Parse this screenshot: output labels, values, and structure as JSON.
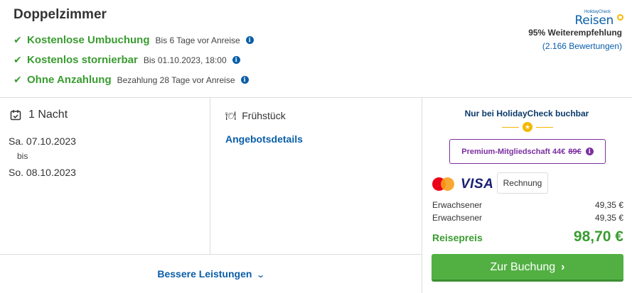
{
  "room": {
    "title": "Doppelzimmer"
  },
  "features": [
    {
      "name": "Kostenlose Umbuchung",
      "detail": "Bis 6 Tage vor Anreise"
    },
    {
      "name": "Kostenlos stornierbar",
      "detail": "Bis 01.10.2023, 18:00"
    },
    {
      "name": "Ohne Anzahlung",
      "detail": "Bezahlung 28 Tage vor Anreise"
    }
  ],
  "brand": {
    "small": "HolidayCheck",
    "name": "Reisen",
    "recommendation": "95% Weiterempfehlung",
    "reviews": "(2.166 Bewertungen)"
  },
  "stay": {
    "nights": "1 Nacht",
    "from": "Sa. 07.10.2023",
    "separator": "bis",
    "to": "So. 08.10.2023"
  },
  "offer": {
    "meal": "Frühstück",
    "details_link": "Angebotsdetails",
    "better_services": "Bessere Leistungen"
  },
  "booking": {
    "exclusive": "Nur bei HolidayCheck buchbar",
    "premium_label": "Premium-Mitgliedschaft 44€",
    "premium_old_price": "89€",
    "payment_visa": "VISA",
    "payment_invoice": "Rechnung",
    "price_rows": [
      {
        "label": "Erwachsener",
        "amount": "49,35 €"
      },
      {
        "label": "Erwachsener",
        "amount": "49,35 €"
      }
    ],
    "total_label": "Reisepreis",
    "total_amount": "98,70 €",
    "cta": "Zur Buchung"
  },
  "colors": {
    "green": "#3a9c31",
    "blue": "#0a5ea8",
    "purple": "#7b2fa0",
    "button": "#52b043"
  },
  "icons": {
    "check": "check-icon",
    "info": "info-icon",
    "calendar": "calendar-icon",
    "meal": "cutlery-icon",
    "chevron": "chevron-down-icon"
  }
}
